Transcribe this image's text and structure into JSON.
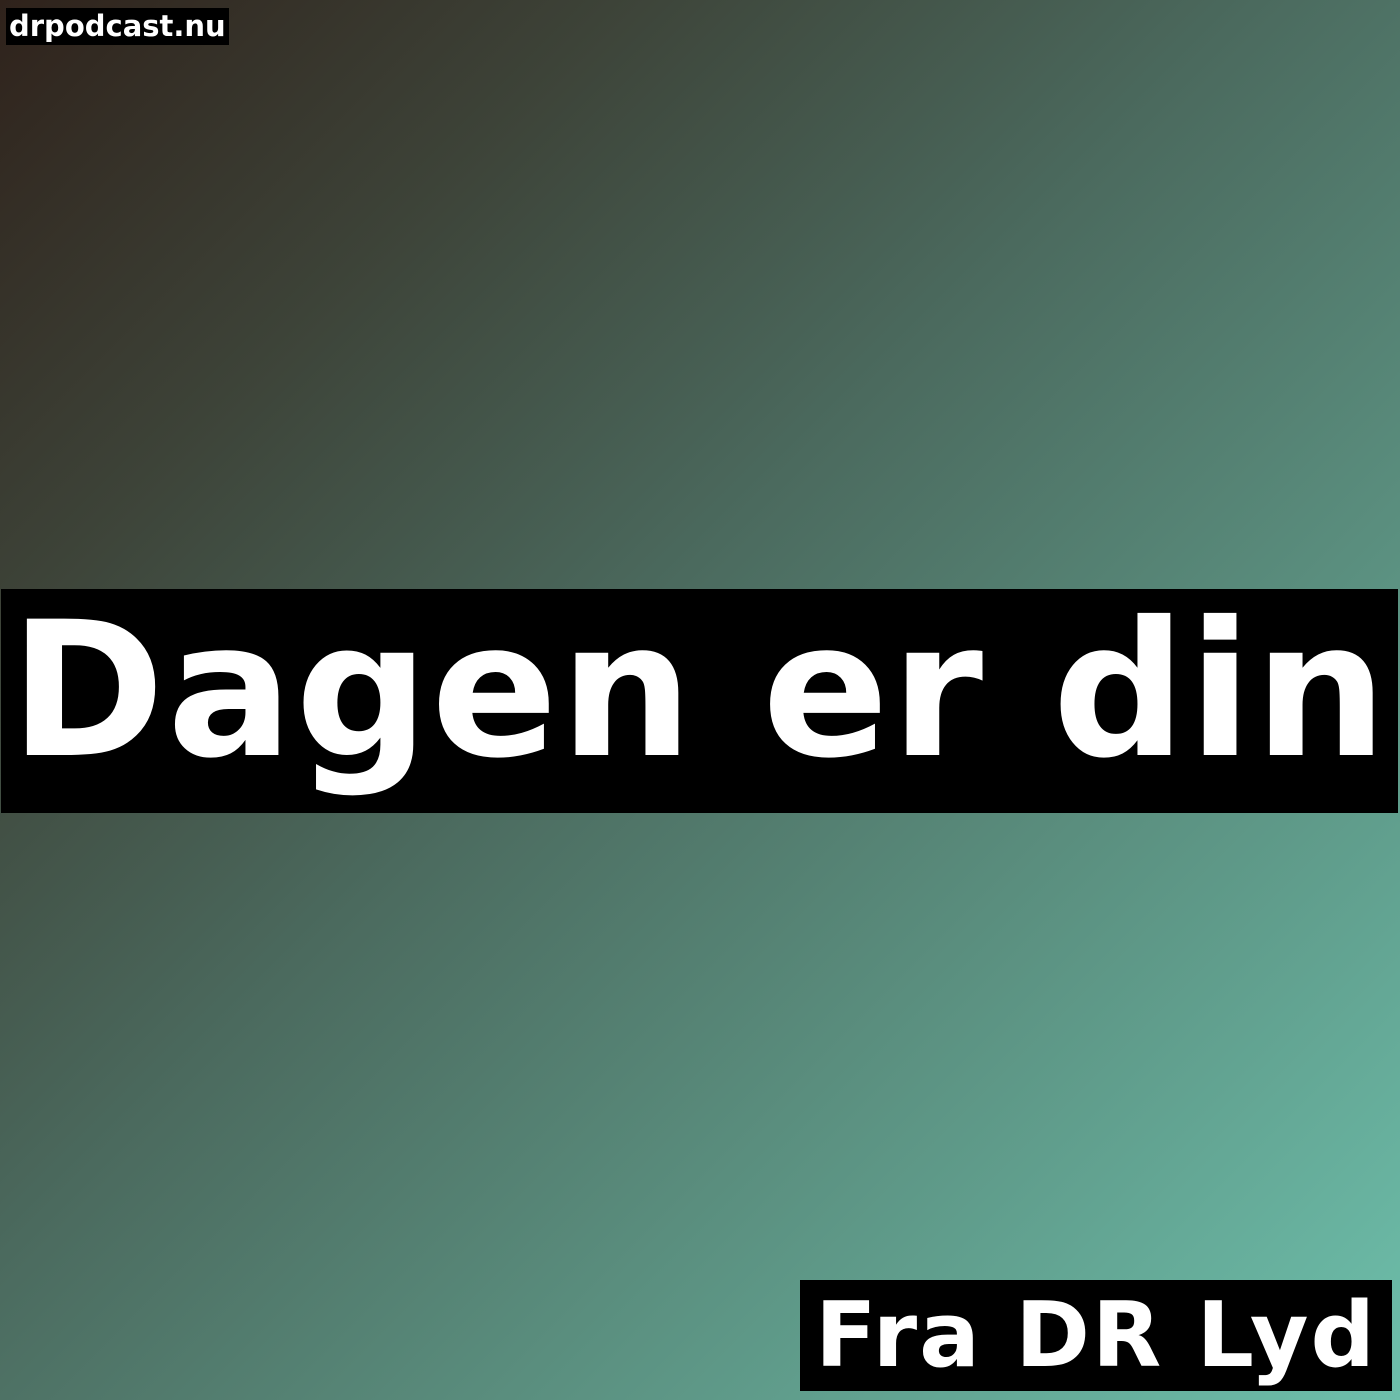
{
  "site_tag": "drpodcast.nu",
  "title": "Dagen er din",
  "source": "Fra DR Lyd",
  "colors": {
    "background_gradient": [
      "#2f221b",
      "#3d4338",
      "#4b6a5e",
      "#5a8e7e",
      "#6dbfab"
    ],
    "label_background": "#000000",
    "label_text": "#ffffff"
  }
}
